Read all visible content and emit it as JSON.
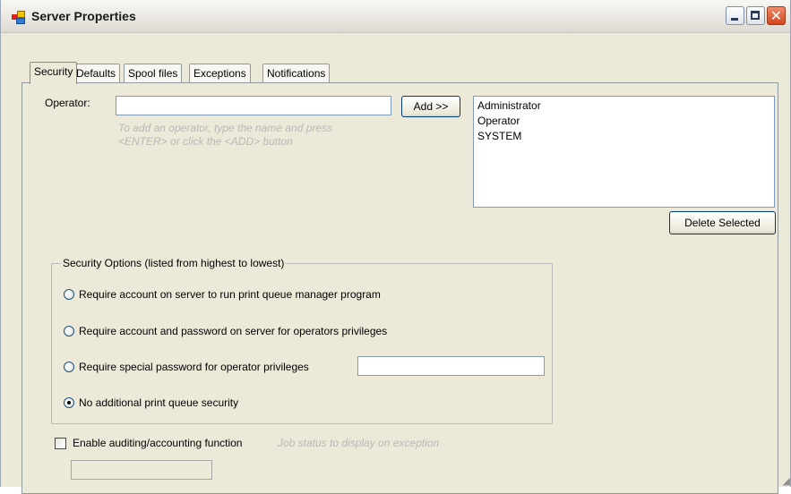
{
  "window": {
    "title": "Server Properties",
    "min_glyph": "",
    "close_glyph": "✕"
  },
  "tabs": [
    {
      "label": "Security",
      "active": true
    },
    {
      "label": "Defaults",
      "active": false
    },
    {
      "label": "Spool files",
      "active": false
    },
    {
      "label": "Exceptions",
      "active": false
    },
    {
      "label": "Notifications",
      "active": false
    }
  ],
  "security": {
    "operator_label": "Operator:",
    "operator_value": "",
    "operator_hint_line1": "To add an operator, type the name and press",
    "operator_hint_line2": "<ENTER> or click the <ADD> button",
    "add_button": "Add >>",
    "operators": [
      "Administrator",
      "Operator",
      "SYSTEM"
    ],
    "delete_button": "Delete Selected",
    "options_group_title": "Security Options (listed from highest to lowest)",
    "options": [
      {
        "label": "Require account on server to run print queue manager program",
        "selected": false
      },
      {
        "label": "Require account and password on server for operators privileges",
        "selected": false
      },
      {
        "label": "Require special password for operator privileges",
        "selected": false
      },
      {
        "label": "No additional print queue security",
        "selected": true
      }
    ],
    "special_password_value": "",
    "auditing_label": "Enable auditing/accounting function",
    "auditing_checked": false,
    "job_status_hint": "Job status to display on exception",
    "job_status_value": ""
  },
  "icons": {
    "app": "app-window-icon",
    "minimize": "minimize-icon",
    "maximize": "maximize-icon",
    "close": "close-icon",
    "resize": "resize-grip-icon"
  }
}
